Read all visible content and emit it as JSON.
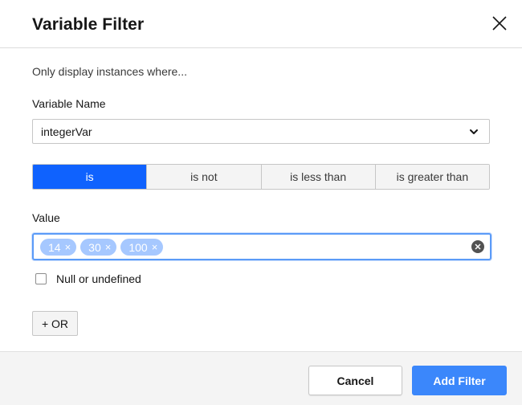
{
  "dialog": {
    "title": "Variable Filter",
    "intro": "Only display instances where..."
  },
  "variable": {
    "label": "Variable Name",
    "selected": "integerVar"
  },
  "operators": {
    "options": [
      "is",
      "is not",
      "is less than",
      "is greater than"
    ],
    "active_index": 0
  },
  "value": {
    "label": "Value",
    "tags": [
      "14",
      "30",
      "100"
    ],
    "tag_remove_glyph": "×"
  },
  "null_option": {
    "label": "Null or undefined",
    "checked": false
  },
  "or_button": {
    "label": "+ OR"
  },
  "footer": {
    "cancel_label": "Cancel",
    "add_label": "Add Filter"
  },
  "colors": {
    "primary": "#0f62fe",
    "tag": "#a6c8ff",
    "focus": "#5b9bf8",
    "footer_bg": "#f4f4f4"
  },
  "icons": {
    "close": "close-icon",
    "dropdown": "chevron-down-icon",
    "clear": "clear-circle-icon"
  }
}
